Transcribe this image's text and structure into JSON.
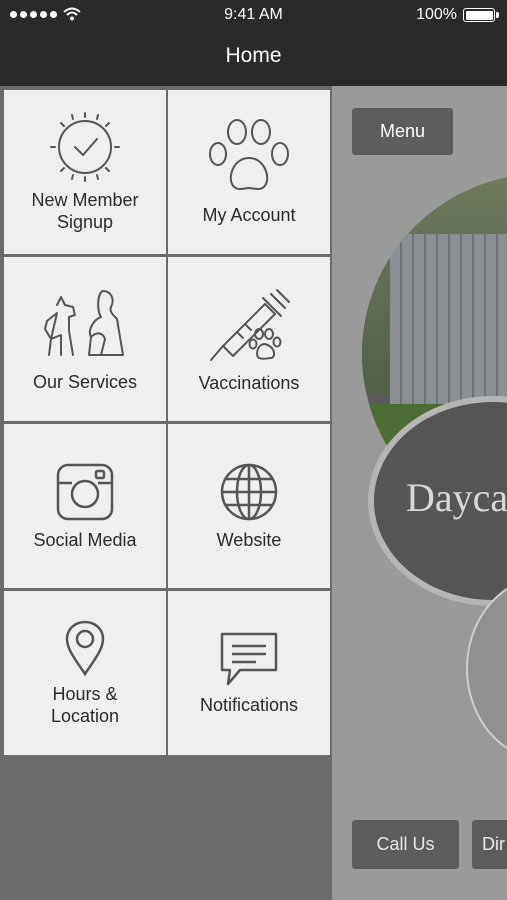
{
  "status_bar": {
    "time": "9:41 AM",
    "battery": "100%"
  },
  "nav": {
    "title": "Home"
  },
  "menu_tiles": [
    {
      "label": "New Member Signup",
      "icon": "check-badge-icon"
    },
    {
      "label": "My Account",
      "icon": "paw-icon"
    },
    {
      "label": "Our Services",
      "icon": "pets-icon"
    },
    {
      "label": "Vaccinations",
      "icon": "syringe-paw-icon"
    },
    {
      "label": "Social Media",
      "icon": "instagram-icon"
    },
    {
      "label": "Website",
      "icon": "globe-icon"
    },
    {
      "label": "Hours & Location",
      "icon": "location-pin-icon"
    },
    {
      "label": "Notifications",
      "icon": "chat-bubble-icon"
    }
  ],
  "content": {
    "menu_button": "Menu",
    "logo_text": "Daycar",
    "call_button": "Call Us",
    "directions_button": "Dir"
  },
  "colors": {
    "bar": "#2a2a2a",
    "tile": "#efefef",
    "icon": "#555555",
    "panel": "#6b6b6b"
  }
}
